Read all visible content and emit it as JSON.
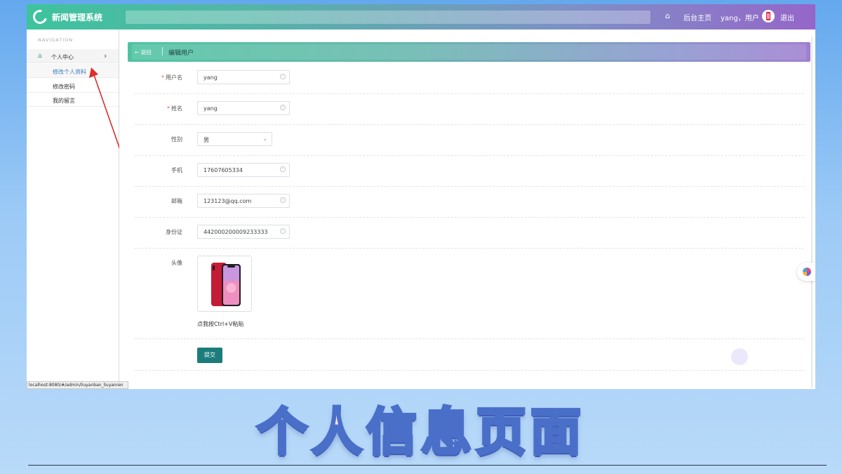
{
  "header": {
    "app_title": "新闻管理系统",
    "home_label": "后台主页",
    "user_greeting": "yang，用户",
    "logout_label": "退出"
  },
  "sidebar": {
    "nav_heading": "NAVIGATION",
    "group_label": "个人中心",
    "items": [
      {
        "label": "修改个人资料",
        "active": true
      },
      {
        "label": "修改密码",
        "active": false
      },
      {
        "label": "我的留言",
        "active": false
      }
    ]
  },
  "breadcrumb": {
    "back_label": "返回",
    "title": "编辑用户"
  },
  "form": {
    "username": {
      "label": "用户名",
      "value": "yang",
      "required": true
    },
    "name": {
      "label": "姓名",
      "value": "yang",
      "required": true
    },
    "gender": {
      "label": "性别",
      "value": "男"
    },
    "phone": {
      "label": "手机",
      "value": "17607605334"
    },
    "email": {
      "label": "邮箱",
      "value": "123123@qq.com"
    },
    "id_card": {
      "label": "身份证",
      "value": "442000200009233333"
    },
    "avatar": {
      "label": "头像",
      "paste_hint": "点我按Ctrl+V粘贴"
    },
    "submit_label": "提交"
  },
  "status_url": "localhost:8080/#/admin/liuyanban_liuyanren",
  "caption": "个人信息页面",
  "colors": {
    "header_gradient_start": "#3ec39d",
    "header_gradient_end": "#9566c9",
    "submit_button": "#1b7c7c",
    "required_mark": "#e05b5b",
    "arrow": "#d9302c"
  }
}
